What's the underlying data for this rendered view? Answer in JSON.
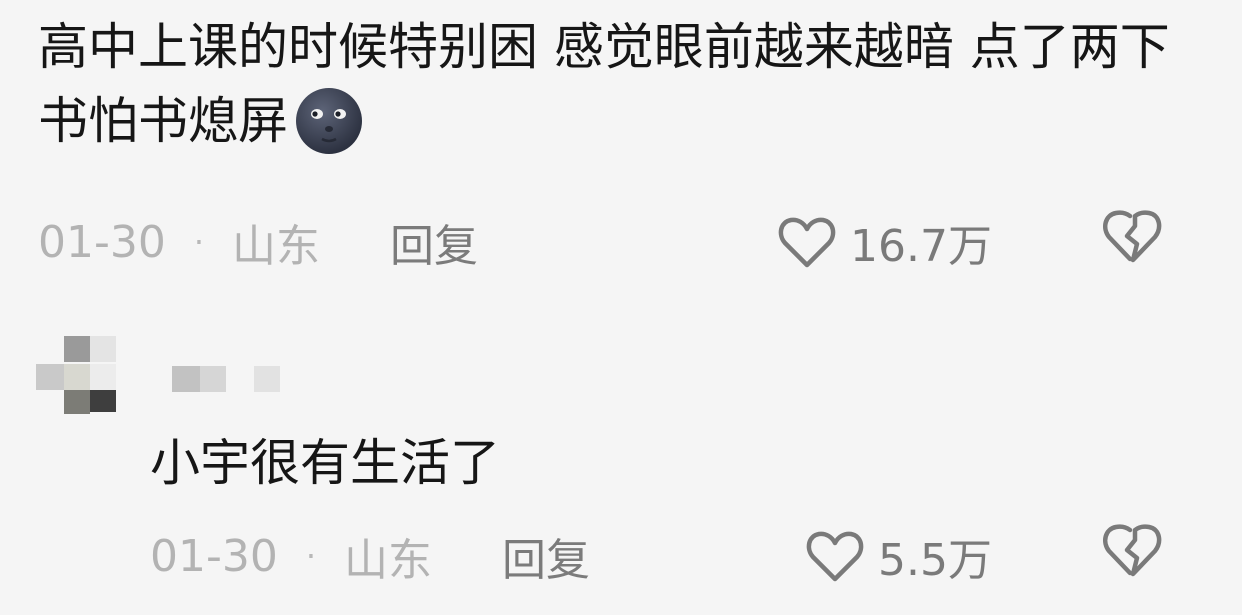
{
  "comments": [
    {
      "text": "高中上课的时候特别困 感觉眼前越来越暗 点了两下书怕书熄屏",
      "emoji": "new-moon-face-icon",
      "date": "01-30",
      "separator": "·",
      "location": "山东",
      "reply_label": "回复",
      "likes": "16.7万"
    },
    {
      "text": "小宇很有生活了",
      "date": "01-30",
      "separator": "·",
      "location": "山东",
      "reply_label": "回复",
      "likes": "5.5万"
    }
  ],
  "colors": {
    "background": "#f5f5f5",
    "text": "#161616",
    "meta": "#b3b3b3",
    "icon": "#7a7a7a"
  }
}
